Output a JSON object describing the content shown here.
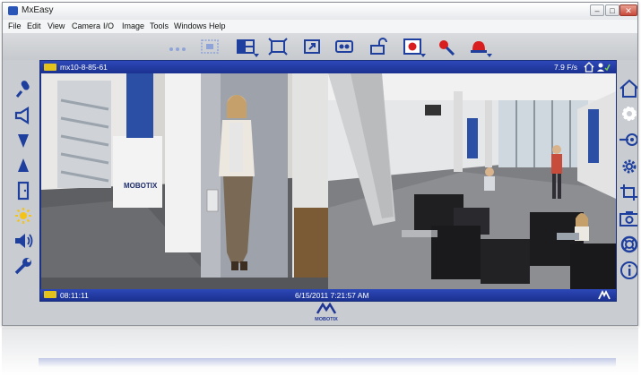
{
  "window": {
    "title": "MxEasy",
    "controls": [
      "minimize-icon",
      "restore-icon",
      "close-icon"
    ]
  },
  "menu": [
    "File",
    "Edit",
    "View",
    "Camera",
    "I/O",
    "Image",
    "Tools",
    "Windows",
    "Help"
  ],
  "toolbar": {
    "items": [
      "previous-cameras-icon",
      "camera-group-icon",
      "layout-icon",
      "fullscreen-icon",
      "window-resize-icon",
      "recording-icon",
      "door-unlock-icon",
      "alarm-icon",
      "event-settings-icon",
      "siren-alarm-icon"
    ],
    "accent": "#1f3f9e",
    "alarm_color": "#d81e1e"
  },
  "left_tools": [
    "microphone-icon",
    "speaker-icon",
    "volume-down-icon",
    "volume-up-icon",
    "door-icon",
    "light-icon",
    "loudspeaker-icon",
    "wrench-icon"
  ],
  "right_tools": [
    "home-icon",
    "gear-rotate-icon",
    "input-icon",
    "settings-icon",
    "crop-icon",
    "snapshot-icon",
    "help-ring-icon",
    "info-icon"
  ],
  "viewer": {
    "camera_name": "mx10-8-85-61",
    "fps": "7.9 F/s",
    "time": "08:11:11",
    "datetime": "6/15/2011 7:21:57 AM",
    "left_view": {
      "mast_text": "MOBOTIX"
    },
    "bar_color": "#1f3596",
    "badge_color": "#e3c21b"
  },
  "brand": {
    "logo_text": "MOBOTIX"
  }
}
